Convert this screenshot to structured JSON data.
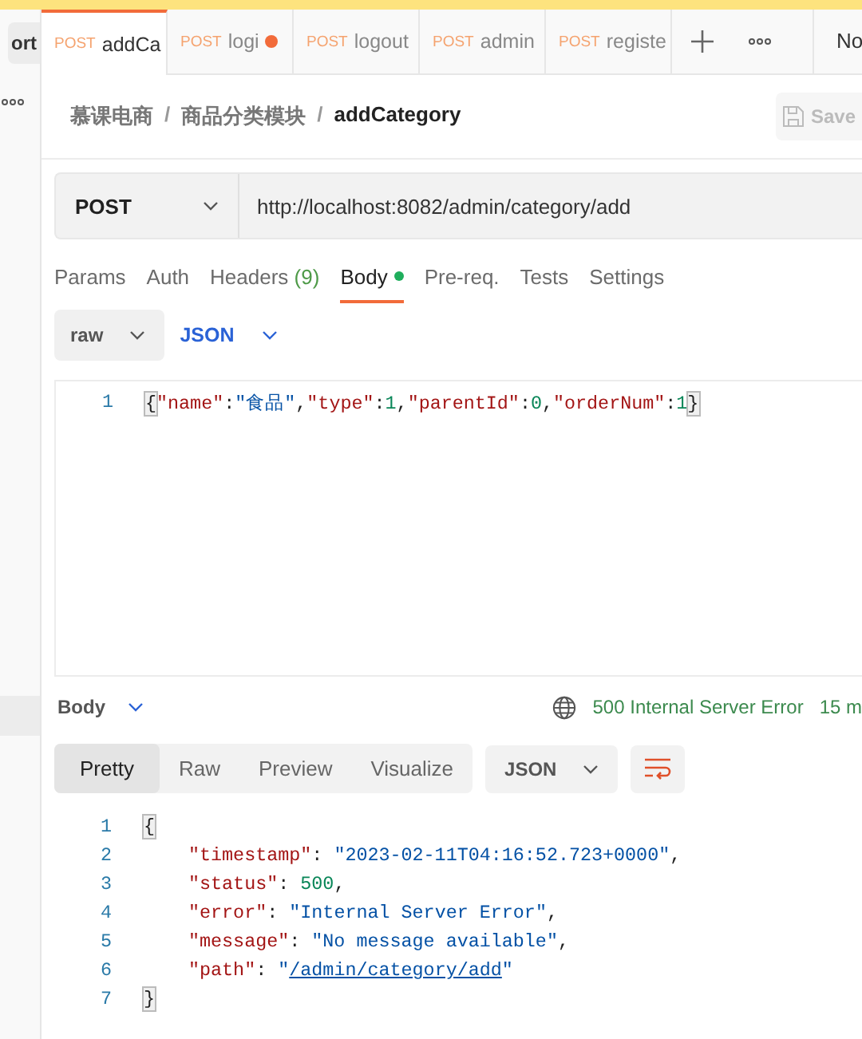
{
  "sidebar": {
    "import_button": "ort"
  },
  "tabs": [
    {
      "method": "POST",
      "name": "addCa",
      "selected": true,
      "unsaved": false
    },
    {
      "method": "POST",
      "name": "logi",
      "selected": false,
      "unsaved": true
    },
    {
      "method": "POST",
      "name": "logout",
      "selected": false,
      "unsaved": false
    },
    {
      "method": "POST",
      "name": "admin",
      "selected": false,
      "unsaved": false
    },
    {
      "method": "POST",
      "name": "registe",
      "selected": false,
      "unsaved": false
    }
  ],
  "environment": "No",
  "breadcrumb": {
    "items": [
      "慕课电商",
      "商品分类模块",
      "addCategory"
    ],
    "separator": "/"
  },
  "save_button": "Save",
  "request": {
    "method": "POST",
    "url": "http://localhost:8082/admin/category/add"
  },
  "request_tabs": [
    {
      "label": "Params",
      "selected": false
    },
    {
      "label": "Auth",
      "selected": false
    },
    {
      "label": "Headers",
      "count": "(9)",
      "selected": false
    },
    {
      "label": "Body",
      "selected": true,
      "has_content": true
    },
    {
      "label": "Pre-req.",
      "selected": false
    },
    {
      "label": "Tests",
      "selected": false
    },
    {
      "label": "Settings",
      "selected": false
    }
  ],
  "body_mode": "raw",
  "body_language": "JSON",
  "request_body": [
    {
      "number": "1",
      "indented": false,
      "tokens": [
        {
          "text": "{",
          "kind": "bracket"
        },
        {
          "text": "\"name\"",
          "kind": "key"
        },
        {
          "text": ":",
          "kind": "punct"
        },
        {
          "text": "\"食品\"",
          "kind": "string"
        },
        {
          "text": ",",
          "kind": "punct"
        },
        {
          "text": "\"type\"",
          "kind": "key"
        },
        {
          "text": ":",
          "kind": "punct"
        },
        {
          "text": "1",
          "kind": "number"
        },
        {
          "text": ",",
          "kind": "punct"
        },
        {
          "text": "\"parentId\"",
          "kind": "key"
        },
        {
          "text": ":",
          "kind": "punct"
        },
        {
          "text": "0",
          "kind": "number"
        },
        {
          "text": ",",
          "kind": "punct"
        },
        {
          "text": "\"orderNum\"",
          "kind": "key"
        },
        {
          "text": ":",
          "kind": "punct"
        },
        {
          "text": "1",
          "kind": "number"
        },
        {
          "text": "}",
          "kind": "bracket"
        }
      ]
    }
  ],
  "response": {
    "section": "Body",
    "status": "500 Internal Server Error",
    "time": "15 m",
    "views": [
      {
        "label": "Pretty",
        "selected": true
      },
      {
        "label": "Raw",
        "selected": false
      },
      {
        "label": "Preview",
        "selected": false
      },
      {
        "label": "Visualize",
        "selected": false
      }
    ],
    "format": "JSON",
    "lines": [
      {
        "number": "1",
        "indented": false,
        "tokens": [
          {
            "text": "{",
            "kind": "bracket"
          }
        ]
      },
      {
        "number": "2",
        "indented": true,
        "tokens": [
          {
            "text": "\"timestamp\"",
            "kind": "key"
          },
          {
            "text": ": ",
            "kind": "punct"
          },
          {
            "text": "\"2023-02-11T04:16:52.723+0000\"",
            "kind": "string"
          },
          {
            "text": ",",
            "kind": "punct"
          }
        ]
      },
      {
        "number": "3",
        "indented": true,
        "tokens": [
          {
            "text": "\"status\"",
            "kind": "key"
          },
          {
            "text": ": ",
            "kind": "punct"
          },
          {
            "text": "500",
            "kind": "number"
          },
          {
            "text": ",",
            "kind": "punct"
          }
        ]
      },
      {
        "number": "4",
        "indented": true,
        "tokens": [
          {
            "text": "\"error\"",
            "kind": "key"
          },
          {
            "text": ": ",
            "kind": "punct"
          },
          {
            "text": "\"Internal Server Error\"",
            "kind": "string"
          },
          {
            "text": ",",
            "kind": "punct"
          }
        ]
      },
      {
        "number": "5",
        "indented": true,
        "tokens": [
          {
            "text": "\"message\"",
            "kind": "key"
          },
          {
            "text": ": ",
            "kind": "punct"
          },
          {
            "text": "\"No message available\"",
            "kind": "string"
          },
          {
            "text": ",",
            "kind": "punct"
          }
        ]
      },
      {
        "number": "6",
        "indented": true,
        "tokens": [
          {
            "text": "\"path\"",
            "kind": "key"
          },
          {
            "text": ": ",
            "kind": "punct"
          },
          {
            "text": "\"",
            "kind": "string"
          },
          {
            "text": "/admin/category/add",
            "kind": "link"
          },
          {
            "text": "\"",
            "kind": "string"
          }
        ]
      },
      {
        "number": "7",
        "indented": false,
        "tokens": [
          {
            "text": "}",
            "kind": "bracket"
          }
        ]
      }
    ]
  }
}
